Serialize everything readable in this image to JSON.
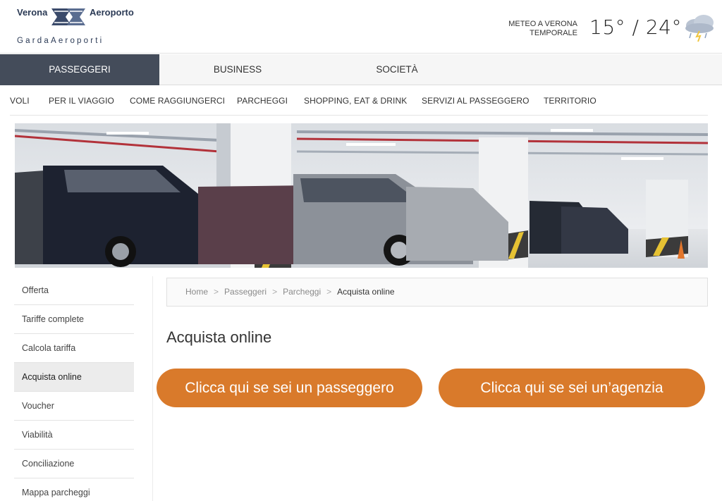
{
  "logo": {
    "name_left": "Verona",
    "name_right": "Aeroporto",
    "subtitle": "GardaAeroporti"
  },
  "weather": {
    "location": "METEO A VERONA",
    "condition": "TEMPORALE",
    "temps": "15° / 24°",
    "icon": "storm-cloud-icon"
  },
  "main_nav": [
    {
      "label": "PASSEGGERI",
      "active": true
    },
    {
      "label": "BUSINESS",
      "active": false
    },
    {
      "label": "SOCIETÀ",
      "active": false
    }
  ],
  "sub_nav": [
    {
      "label": "VOLI"
    },
    {
      "label": "PER IL VIAGGIO"
    },
    {
      "label": "COME RAGGIUNGERCI"
    },
    {
      "label": "PARCHEGGI"
    },
    {
      "label": "SHOPPING, EAT & DRINK"
    },
    {
      "label": "SERVIZI AL PASSEGGERO"
    },
    {
      "label": "TERRITORIO"
    }
  ],
  "sidebar": [
    {
      "label": "Offerta"
    },
    {
      "label": "Tariffe complete"
    },
    {
      "label": "Calcola tariffa"
    },
    {
      "label": "Acquista online",
      "active": true
    },
    {
      "label": "Voucher"
    },
    {
      "label": "Viabilità"
    },
    {
      "label": "Conciliazione"
    },
    {
      "label": "Mappa parcheggi"
    }
  ],
  "breadcrumb": {
    "items": [
      "Home",
      "Passeggeri",
      "Parcheggi"
    ],
    "current": "Acquista online",
    "separator": ">"
  },
  "page": {
    "title": "Acquista online",
    "cta_passenger": "Clicca qui se sei un passeggero",
    "cta_agency": "Clicca qui se sei un’agenzia"
  },
  "colors": {
    "accent_orange": "#d97a2b",
    "nav_active": "#444c5a",
    "brand_navy": "#2b3a55"
  }
}
